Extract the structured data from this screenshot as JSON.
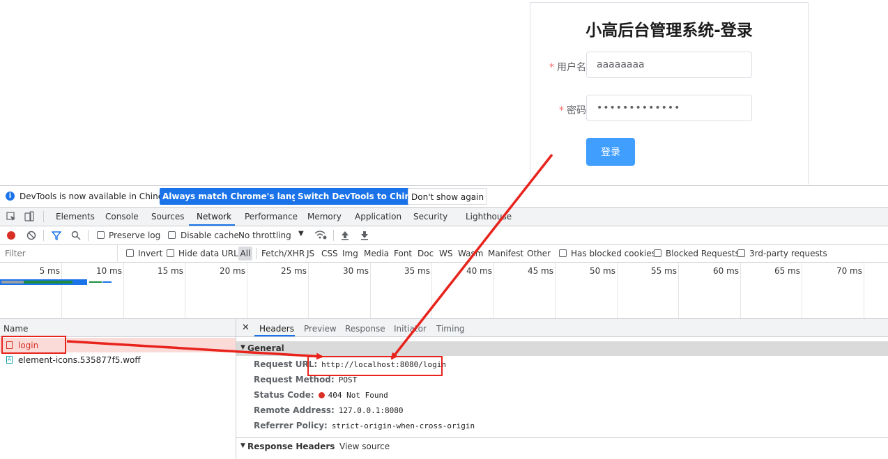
{
  "login": {
    "title": "小高后台管理系统-登录",
    "username_label": "用户名",
    "username_value": "aaaaaaaa",
    "password_label": "密码",
    "password_value": "•••••••••••••",
    "required_mark": "*",
    "submit_label": "登录"
  },
  "infobar": {
    "message": "DevTools is now available in Chinese!",
    "btn_match": "Always match Chrome's language",
    "btn_switch": "Switch DevTools to Chinese",
    "btn_dismiss": "Don't show again"
  },
  "tabs": [
    "Elements",
    "Console",
    "Sources",
    "Network",
    "Performance",
    "Memory",
    "Application",
    "Security",
    "Lighthouse"
  ],
  "active_tab": "Network",
  "toolbar": {
    "preserve_log": "Preserve log",
    "disable_cache": "Disable cache",
    "throttling": "No throttling"
  },
  "filterbar": {
    "placeholder": "Filter",
    "invert": "Invert",
    "hide_data_urls": "Hide data URLs",
    "types": [
      "All",
      "Fetch/XHR",
      "JS",
      "CSS",
      "Img",
      "Media",
      "Font",
      "Doc",
      "WS",
      "Wasm",
      "Manifest",
      "Other"
    ],
    "has_blocked_cookies": "Has blocked cookies",
    "blocked_requests": "Blocked Requests",
    "third_party": "3rd-party requests"
  },
  "timeline": {
    "ticks": [
      "5 ms",
      "10 ms",
      "15 ms",
      "20 ms",
      "25 ms",
      "30 ms",
      "35 ms",
      "40 ms",
      "45 ms",
      "50 ms",
      "55 ms",
      "60 ms",
      "65 ms",
      "70 ms"
    ]
  },
  "requests": {
    "column_name": "Name",
    "rows": [
      {
        "name": "login",
        "status": "error"
      },
      {
        "name": "element-icons.535877f5.woff",
        "status": "ok"
      }
    ]
  },
  "details": {
    "tabs": [
      "Headers",
      "Preview",
      "Response",
      "Initiator",
      "Timing"
    ],
    "active_tab": "Headers",
    "general_title": "General",
    "general": [
      {
        "key": "Request URL:",
        "value": "http://localhost:8080/login"
      },
      {
        "key": "Request Method:",
        "value": "POST"
      },
      {
        "key": "Status Code:",
        "value": "404 Not Found"
      },
      {
        "key": "Remote Address:",
        "value": "127.0.0.1:8080"
      },
      {
        "key": "Referrer Policy:",
        "value": "strict-origin-when-cross-origin"
      }
    ],
    "response_headers_title": "Response Headers",
    "view_source": "View source"
  },
  "colors": {
    "accent": "#1a73e8",
    "button_primary": "#409eff",
    "error": "#d93025",
    "annotation": "#e8231c"
  }
}
